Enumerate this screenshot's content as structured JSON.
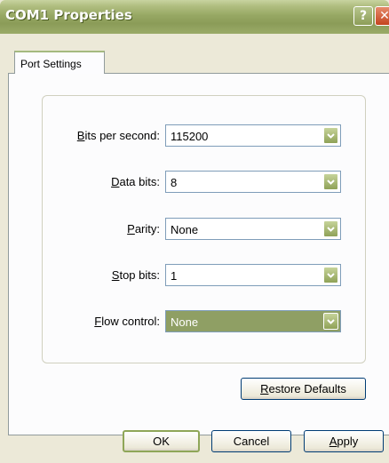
{
  "window": {
    "title": "COM1 Properties",
    "help_glyph": "?",
    "close_glyph": "✕"
  },
  "tabs": [
    {
      "label": "Port Settings",
      "selected": true
    }
  ],
  "fields": [
    {
      "accel": "B",
      "rest": "its per second:",
      "value": "115200"
    },
    {
      "accel": "D",
      "rest": "ata bits:",
      "value": "8"
    },
    {
      "accel": "P",
      "rest": "arity:",
      "value": "None"
    },
    {
      "accel": "S",
      "rest": "top bits:",
      "value": "1"
    },
    {
      "accel": "F",
      "rest": "low control:",
      "value": "None",
      "selected": true
    }
  ],
  "buttons": {
    "restore": {
      "accel": "R",
      "rest": "estore Defaults"
    },
    "ok": {
      "label": "OK"
    },
    "cancel": {
      "label": "Cancel"
    },
    "apply": {
      "accel": "A",
      "rest": "pply"
    }
  },
  "colors": {
    "titlebar": "#97a864",
    "dialog_bg": "#ece9d8",
    "combo_arrow": "#8fa257",
    "selection": "#8f9f64"
  }
}
